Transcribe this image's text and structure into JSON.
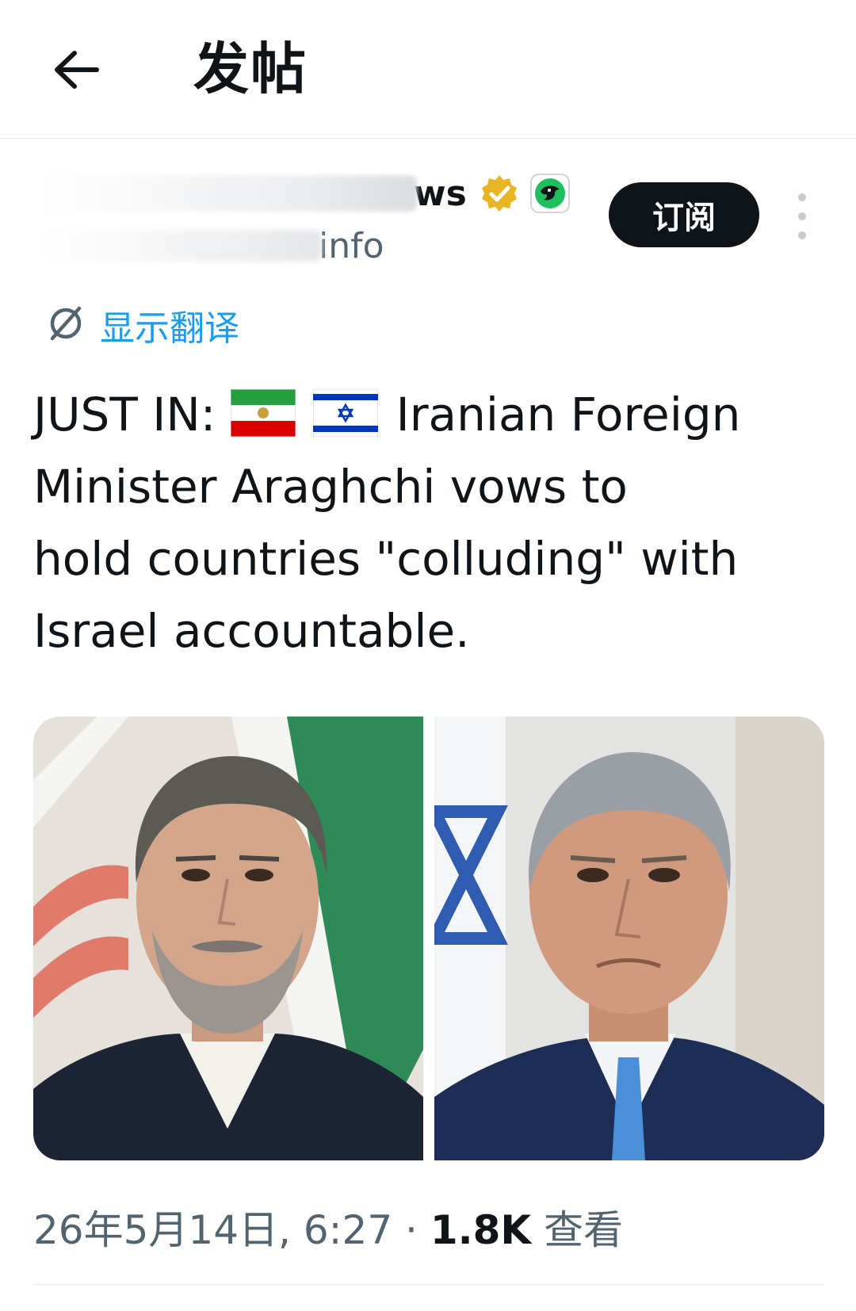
{
  "header": {
    "title": "发帖"
  },
  "author": {
    "name_tail": "ws",
    "handle_tail": "info"
  },
  "actions": {
    "subscribe": "订阅"
  },
  "translate": {
    "label": "显示翻译"
  },
  "post": {
    "prefix": "JUST IN:",
    "line1": "Iranian Foreign",
    "line2": "Minister Araghchi vows to",
    "line3": "hold countries \"colluding\" with",
    "line4": "Israel accountable."
  },
  "meta": {
    "timestamp": "26年5月14日, 6:27",
    "separator": "·",
    "views_count": "1.8K",
    "views_label": "查看"
  },
  "icons": [
    "back-arrow-icon",
    "verified-badge-icon",
    "affiliate-badge-icon",
    "more-options-icon",
    "translate-icon",
    "iran-flag-icon",
    "israel-flag-icon"
  ],
  "colors": {
    "accent": "#1d9bf0",
    "text": "#0f1419",
    "secondary": "#536471",
    "verified": "#e8b527",
    "affiliate": "#1fbf5f"
  }
}
